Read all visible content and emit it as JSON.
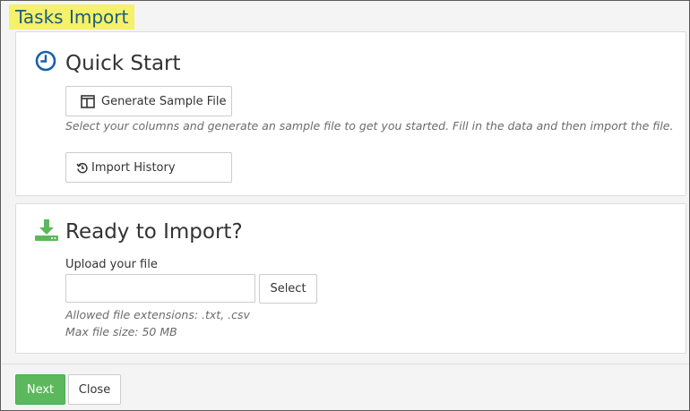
{
  "dialog": {
    "title": "Tasks Import"
  },
  "quick_start": {
    "heading": "Quick Start",
    "icon": "clock-icon",
    "generate_label": "Generate Sample File",
    "generate_icon": "columns-icon",
    "description": "Select your columns and generate an sample file to get you started. Fill in the data and then import the file.",
    "history_label": "Import History",
    "history_icon": "history-icon"
  },
  "ready": {
    "heading": "Ready to Import?",
    "icon": "download-icon",
    "upload_label": "Upload your file",
    "file_value": "",
    "select_label": "Select",
    "allowed_ext": "Allowed file extensions: .txt, .csv",
    "max_size": "Max file size: 50 MB"
  },
  "footer": {
    "next_label": "Next",
    "close_label": "Close"
  },
  "colors": {
    "title_highlight": "#f6f16a",
    "title_text": "#1c5d7a",
    "icon_blue": "#1b5fa8",
    "icon_green": "#5cb85c",
    "next_button": "#5cb85c"
  }
}
